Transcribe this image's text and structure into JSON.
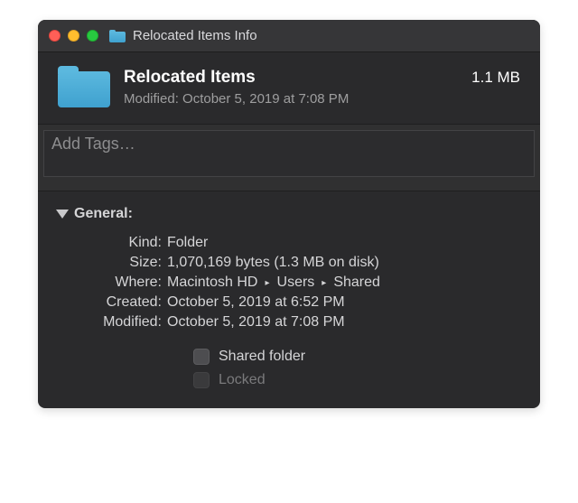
{
  "window": {
    "title": "Relocated Items Info"
  },
  "header": {
    "name": "Relocated Items",
    "size": "1.1 MB",
    "modified": "Modified: October 5, 2019 at 7:08 PM"
  },
  "tags": {
    "placeholder": "Add Tags…"
  },
  "general": {
    "label": "General:",
    "kind": {
      "label": "Kind:",
      "value": "Folder"
    },
    "size": {
      "label": "Size:",
      "value": "1,070,169 bytes (1.3 MB on disk)"
    },
    "where": {
      "label": "Where:",
      "p1": "Macintosh HD",
      "p2": "Users",
      "p3": "Shared"
    },
    "created": {
      "label": "Created:",
      "value": "October 5, 2019 at 6:52 PM"
    },
    "modified": {
      "label": "Modified:",
      "value": "October 5, 2019 at 7:08 PM"
    },
    "shared": {
      "label": "Shared folder"
    },
    "locked": {
      "label": "Locked"
    }
  }
}
